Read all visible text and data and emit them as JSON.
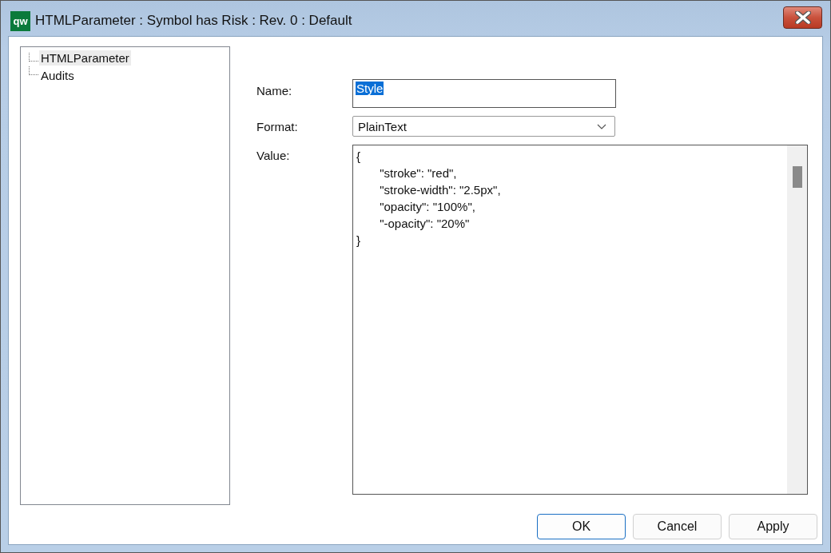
{
  "window": {
    "title": "HTMLParameter : Symbol has Risk : Rev. 0  : Default",
    "app_icon": "qw"
  },
  "tree": {
    "items": [
      {
        "label": "HTMLParameter",
        "selected": true
      },
      {
        "label": "Audits",
        "selected": false
      }
    ]
  },
  "form": {
    "name": {
      "label": "Name:",
      "value": "Style",
      "text_selected": true
    },
    "format": {
      "label": "Format:",
      "value": "PlainText"
    },
    "value": {
      "label": "Value:",
      "text": "{\n\t\"stroke\": \"red\",\n\t\"stroke-width\": \"2.5px\",\n\t\"opacity\": \"100%\",\n\t\"-opacity\": \"20%\"\n}"
    }
  },
  "buttons": [
    {
      "label": "OK",
      "default": true
    },
    {
      "label": "Cancel",
      "default": false
    },
    {
      "label": "Apply",
      "default": false
    }
  ]
}
